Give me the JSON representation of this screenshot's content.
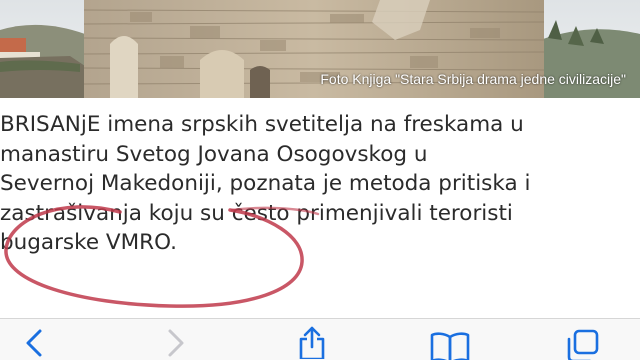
{
  "photo": {
    "caption": "Foto Knjiga \"Stara Srbija drama jedne civilizacije\""
  },
  "article": {
    "lines": [
      "BRISANjE imena srpskih svetitelja na freskama u",
      "manastiru Svetog Jovana Osogovskog u",
      "Severnoj Makedoniji, poznata je metoda pritiska i",
      "zastrašivanja koju su često primenjivali teroristi",
      "bugarske VMRO."
    ]
  },
  "colors": {
    "text": "#2b2b2b",
    "marker": "#c0394b",
    "toolbar_icon_active": "#1a6fe0",
    "toolbar_icon_disabled": "#c7c7cc"
  },
  "toolbar": {
    "items": [
      {
        "icon": "chevron-left-icon",
        "enabled": true
      },
      {
        "icon": "chevron-right-icon",
        "enabled": false
      },
      {
        "icon": "share-icon",
        "enabled": true
      },
      {
        "icon": "book-icon",
        "enabled": true
      },
      {
        "icon": "tabs-icon",
        "enabled": true
      }
    ]
  }
}
